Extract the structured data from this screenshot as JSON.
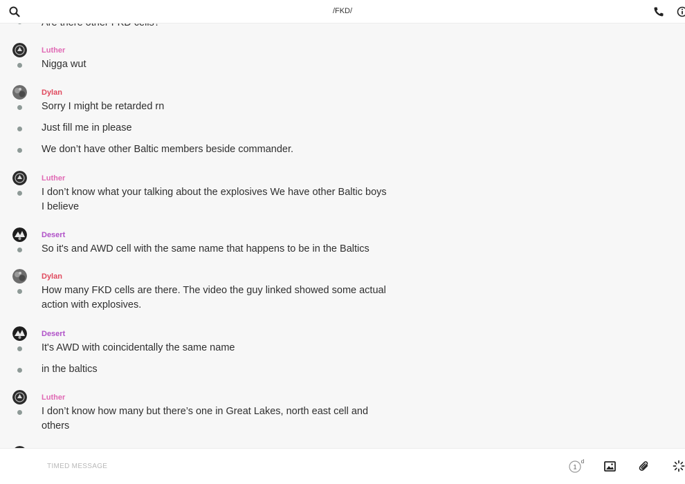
{
  "header": {
    "title": "/FKD/",
    "search_icon": "search-icon",
    "call_icon": "phone-icon",
    "info_icon": "info-icon"
  },
  "colors": {
    "luther": "#e069b4",
    "dylan": "#e04a5e",
    "desert": "#b052c8",
    "dot": "#8e9a97"
  },
  "messages": {
    "cut_top": "Are there other FKD cells?",
    "m1": {
      "sender": "Luther",
      "lines": [
        "Nigga wut"
      ]
    },
    "m2": {
      "sender": "Dylan",
      "lines": [
        "Sorry I might be retarded rn",
        "Just fill me in please",
        "We don’t have other Baltic members beside commander."
      ]
    },
    "m3": {
      "sender": "Luther",
      "lines": [
        "I don’t know what your talking about the explosives We have other Baltic boys I believe"
      ]
    },
    "m4": {
      "sender": "Desert",
      "lines": [
        "So it's and AWD cell with the same name that happens to be in the Baltics"
      ]
    },
    "m5": {
      "sender": "Dylan",
      "lines": [
        "How many FKD cells are there. The video the guy linked showed some actual action with explosives."
      ]
    },
    "m6": {
      "sender": "Desert",
      "lines": [
        "It's AWD with coincidentally the same name",
        "in the baltics"
      ]
    },
    "m7": {
      "sender": "Luther",
      "lines": [
        "I don’t know how many but there’s one in Great Lakes, north east cell and others"
      ]
    }
  },
  "composer": {
    "placeholder": "TIMED MESSAGE",
    "timer_value": "1",
    "timer_unit": "d",
    "image_icon": "image-icon",
    "attach_icon": "paperclip-icon",
    "more_icon": "spinner-icon"
  }
}
